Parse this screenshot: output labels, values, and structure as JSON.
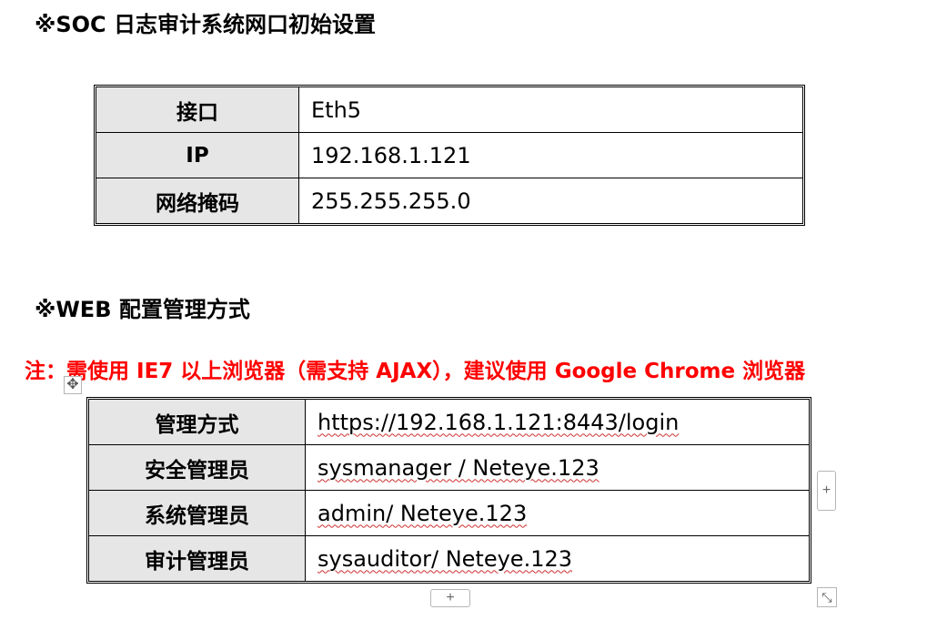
{
  "section1": {
    "heading": "※SOC 日志审计系统网口初始设置",
    "rows": [
      {
        "label": "接口",
        "value": "Eth5"
      },
      {
        "label": "IP",
        "value": "192.168.1.121"
      },
      {
        "label": "网络掩码",
        "value": "255.255.255.0"
      }
    ]
  },
  "section2": {
    "heading": "※WEB 配置管理方式",
    "note": "注：需使用 IE7 以上浏览器（需支持 AJAX），建议使用 Google Chrome 浏览器",
    "rows": [
      {
        "label": "管理方式",
        "value": "https://192.168.1.121:8443/login"
      },
      {
        "label": "安全管理员",
        "value": "sysmanager / Neteye.123"
      },
      {
        "label": "系统管理员",
        "value": "admin/ Neteye.123"
      },
      {
        "label": "审计管理员",
        "value": "sysauditor/ Neteye.123"
      }
    ]
  },
  "table_controls": {
    "move_icon": "move-arrows-icon",
    "add_column_icon": "plus-icon",
    "add_row_icon": "plus-icon",
    "resize_icon": "diagonal-resize-icon"
  },
  "colors": {
    "note_text": "#ff0000",
    "label_cell_bg": "#e6e6e6",
    "spellcheck_underline": "#d03030"
  }
}
